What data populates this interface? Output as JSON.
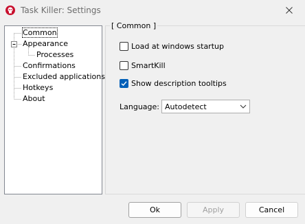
{
  "window": {
    "title": "Task Killer: Settings"
  },
  "tree": {
    "items": [
      {
        "label": "Common"
      },
      {
        "label": "Appearance"
      },
      {
        "label": "Processes"
      },
      {
        "label": "Confirmations"
      },
      {
        "label": "Excluded applications"
      },
      {
        "label": "Hotkeys"
      },
      {
        "label": "About"
      }
    ]
  },
  "panel": {
    "caption": "[ Common ]",
    "options": [
      {
        "label": "Load at windows startup",
        "checked": false
      },
      {
        "label": "SmartKill",
        "checked": false
      },
      {
        "label": "Show description tooltips",
        "checked": true
      }
    ],
    "language": {
      "label": "Language:",
      "value": "Autodetect"
    }
  },
  "buttons": {
    "ok": "Ok",
    "apply": "Apply",
    "cancel": "Cancel"
  },
  "colors": {
    "accent": "#005fb8",
    "icon_red": "#c8102e"
  }
}
